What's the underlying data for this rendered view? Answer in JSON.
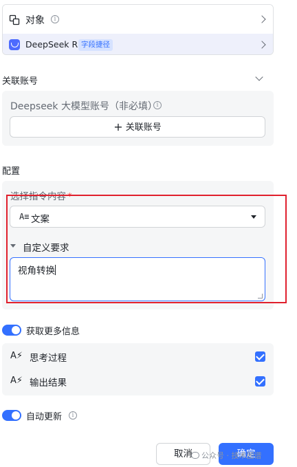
{
  "top_card": {
    "object_label": "对象",
    "model_label": "DeepSeek R1",
    "model_tag": "字段捷径"
  },
  "account_section": {
    "title": "关联账号",
    "field_label": "Deepseek 大模型账号（非必填）",
    "add_button_label": "关联账号"
  },
  "config_section": {
    "title": "配置",
    "instruction_label": "选择指令内容",
    "instruction_required_mark": "*",
    "instruction_value": "文案",
    "instruction_type_icon": "A≡",
    "custom_requirement_label": "自定义要求",
    "custom_requirement_value": "视角转换"
  },
  "more_info": {
    "toggle_label": "获取更多信息",
    "toggle_on": true,
    "options": [
      {
        "label": "思考过程",
        "checked": true,
        "icon": "A⚡"
      },
      {
        "label": "输出结果",
        "checked": true,
        "icon": "A⚡"
      }
    ]
  },
  "auto_update": {
    "toggle_label": "自动更新",
    "toggle_on": true
  },
  "footer": {
    "cancel_label": "取消",
    "ok_label": "确定",
    "watermark": "公众号 · 技术图谱"
  },
  "colors": {
    "accent": "#3370ff",
    "highlight_border": "#e01f2c",
    "model_row_bg": "#eef0fb"
  }
}
